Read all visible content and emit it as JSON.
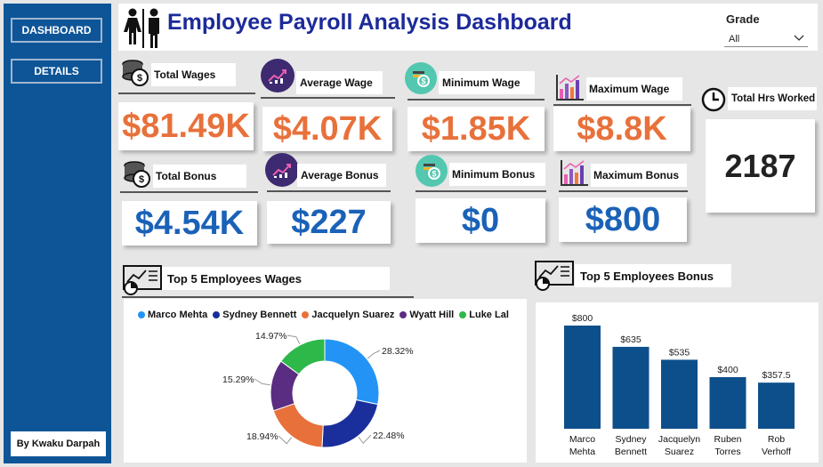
{
  "sidebar": {
    "buttons": [
      {
        "label": "DASHBOARD"
      },
      {
        "label": "DETAILS"
      }
    ],
    "author": "By Kwaku Darpah"
  },
  "header": {
    "title": "Employee Payroll Analysis Dashboard",
    "icon": "restroom-people-icon"
  },
  "filter": {
    "label": "Grade",
    "value": "All"
  },
  "kpis": {
    "total_wages": {
      "label": "Total Wages",
      "value": "$81.49K",
      "icon": "coins-icon"
    },
    "average_wage": {
      "label": "Average Wage",
      "value": "$4.07K",
      "icon": "growth-chart-icon"
    },
    "minimum_wage": {
      "label": "Minimum Wage",
      "value": "$1.85K",
      "icon": "cash-coin-icon"
    },
    "maximum_wage": {
      "label": "Maximum Wage",
      "value": "$8.8K",
      "icon": "bar-chart-icon"
    },
    "total_bonus": {
      "label": "Total Bonus",
      "value": "$4.54K",
      "icon": "coins-icon"
    },
    "average_bonus": {
      "label": "Average Bonus",
      "value": "$227",
      "icon": "growth-chart-icon"
    },
    "minimum_bonus": {
      "label": "Minimum Bonus",
      "value": "$0",
      "icon": "cash-coin-icon"
    },
    "maximum_bonus": {
      "label": "Maximum Bonus",
      "value": "$800",
      "icon": "bar-chart-icon"
    },
    "total_hours": {
      "label": "Total Hrs Worked",
      "value": "2187",
      "icon": "clock-icon"
    }
  },
  "colors": {
    "sidebar": "#0d5597",
    "title": "#1c2a9a",
    "orange_value": "#e8713b",
    "blue_value": "#1a62b7",
    "bar": "#0d4f8b"
  },
  "chart_data": [
    {
      "type": "pie",
      "title": "Top 5 Employees Wages",
      "donut": true,
      "legend": "top",
      "categories": [
        "Marco Mehta",
        "Sydney Bennett",
        "Jacquelyn Suarez",
        "Wyatt Hill",
        "Luke Lal"
      ],
      "values": [
        28.32,
        22.48,
        18.94,
        15.29,
        14.97
      ],
      "labels": [
        "28.32%",
        "22.48%",
        "18.94%",
        "15.29%",
        "14.97%"
      ],
      "colors": [
        "#2394f5",
        "#1a2e9c",
        "#e8713b",
        "#5a2d82",
        "#2eb84a"
      ]
    },
    {
      "type": "bar",
      "title": "Top 5 Employees Bonus",
      "categories": [
        "Marco Mehta",
        "Sydney Bennett",
        "Jacquelyn Suarez",
        "Ruben Torres",
        "Rob Verhoff"
      ],
      "category_lines": [
        [
          "Marco",
          "Mehta"
        ],
        [
          "Sydney",
          "Bennett"
        ],
        [
          "Jacquelyn",
          "Suarez"
        ],
        [
          "Ruben",
          "Torres"
        ],
        [
          "Rob",
          "Verhoff"
        ]
      ],
      "values": [
        800,
        635,
        535,
        400,
        357.5
      ],
      "labels": [
        "$800",
        "$635",
        "$535",
        "$400",
        "$357.5"
      ],
      "ylim": [
        0,
        800
      ],
      "color": "#0d4f8b"
    }
  ]
}
